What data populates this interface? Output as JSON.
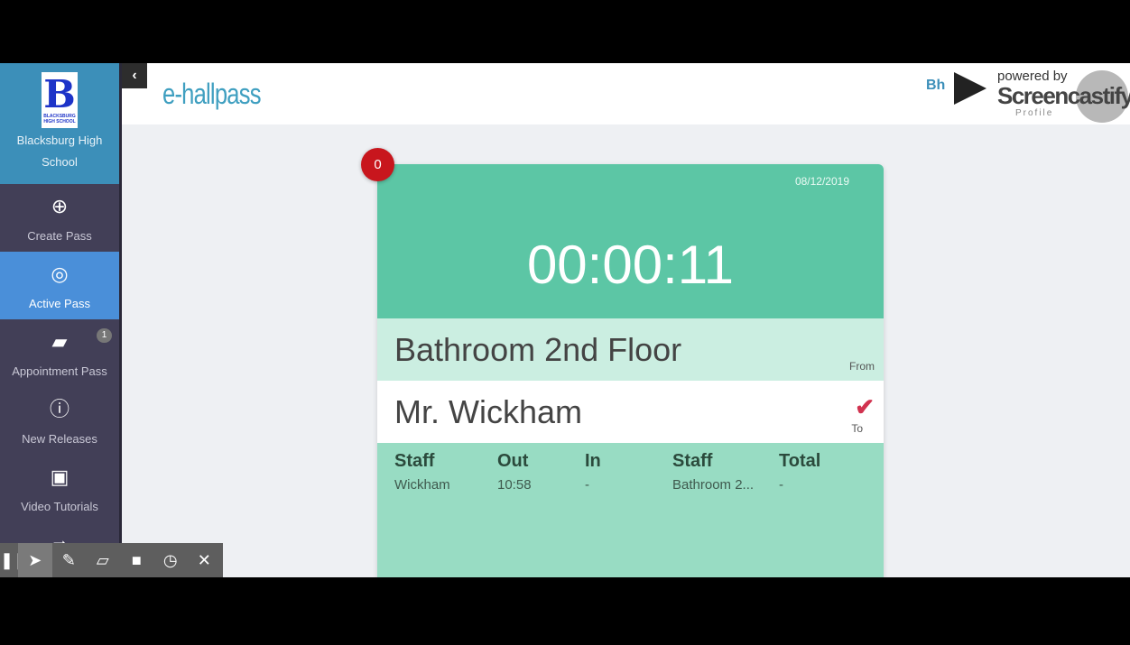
{
  "sidebar": {
    "school_name": "Blacksburg High School",
    "logo": {
      "letter": "B",
      "caption": "BLACKSBURG HIGH SCHOOL"
    },
    "items": [
      {
        "label": "Create Pass",
        "icon": "plus-circle-icon"
      },
      {
        "label": "Active Pass",
        "icon": "compass-icon",
        "active": true
      },
      {
        "label": "Appointment Pass",
        "icon": "book-icon",
        "badge": "1"
      },
      {
        "label": "New Releases",
        "icon": "info-circle-icon"
      },
      {
        "label": "Video Tutorials",
        "icon": "video-file-icon"
      }
    ]
  },
  "header": {
    "brand": "e-hallpass",
    "user_initials": "Bh"
  },
  "watermark": {
    "powered_by": "powered by",
    "name": "Screencastify",
    "profile": "Profile"
  },
  "pass": {
    "badge_count": "0",
    "date": "08/12/2019",
    "timer": "00:00:11",
    "from": "Bathroom 2nd Floor",
    "from_label": "From",
    "to": "Mr. Wickham",
    "to_label": "To",
    "columns": [
      "Staff",
      "Out",
      "In",
      "Staff",
      "Total"
    ],
    "row": [
      "Wickham",
      "10:58",
      "-",
      "Bathroom 2...",
      "-"
    ]
  },
  "colors": {
    "header_green": "#5cc6a5",
    "active_blue": "#4a8fd9",
    "badge_red": "#c8161d",
    "check_red": "#d1324f"
  },
  "toolbar": [
    "pause-icon",
    "cursor-icon",
    "pen-icon",
    "eraser-icon",
    "camera-icon",
    "timer-icon",
    "close-icon"
  ]
}
